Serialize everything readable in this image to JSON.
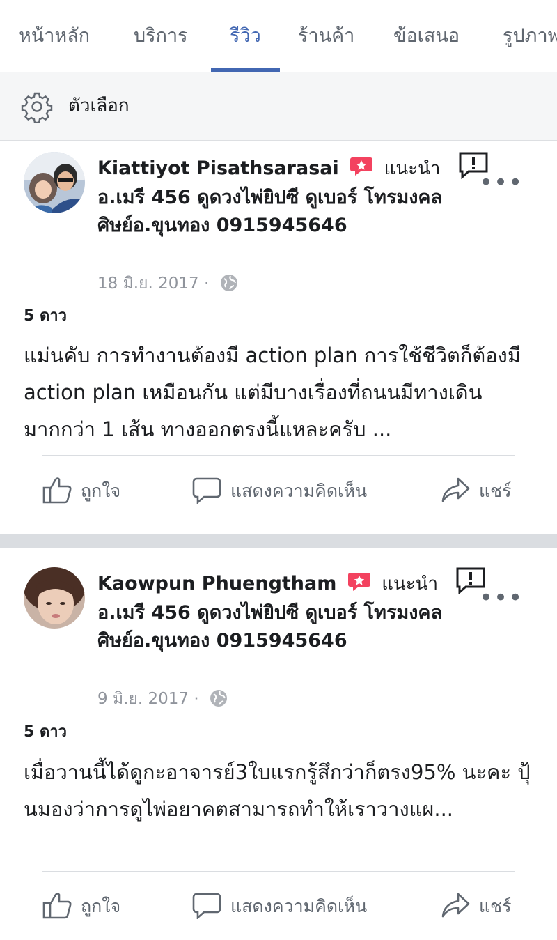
{
  "tabs": [
    "หน้าหลัก",
    "บริการ",
    "รีวิว",
    "ร้านค้า",
    "ข้อเสนอ",
    "รูปภาพ"
  ],
  "options_label": "ตัวเลือก",
  "reviews": [
    {
      "author": "Kiattiyot Pisathsarasai",
      "recommends": "แนะนำ",
      "page_name": "อ.เมรี 456 ดูดวงไพ่ยิปซี ดูเบอร์ โทรมงคล ศิษย์อ.ขุนทอง 0915945646",
      "date": "18 มิ.ย. 2017 ·",
      "rating": "5 ดาว",
      "text": "แม่นคับ การทำงานต้องมี action plan การใช้ชีวิตก็ต้องมี action plan เหมือนกัน แต่มีบางเรื่องที่ถนนมีทางเดินมากกว่า 1 เส้น ทางออกตรงนี้แหละครับ ...",
      "actions": {
        "like": "ถูกใจ",
        "comment": "แสดงความคิดเห็น",
        "share": "แชร์"
      }
    },
    {
      "author": "Kaowpun Phuengtham",
      "recommends": "แนะนำ",
      "page_name": "อ.เมรี 456 ดูดวงไพ่ยิปซี ดูเบอร์ โทรมงคล ศิษย์อ.ขุนทอง 0915945646",
      "date": "9 มิ.ย. 2017 ·",
      "rating": "5 ดาว",
      "text": "เมื่อวานนี้ได้ดูกะอาจารย์3ใบแรกรู้สึกว่าก็ตรง95% นะคะ ปุ้นมองว่าการดูไพ่อยาคตสามารถทำให้เราวางแผ...",
      "actions": {
        "like": "ถูกใจ",
        "comment": "แสดงความคิดเห็น",
        "share": "แชร์"
      }
    }
  ],
  "colors": {
    "accent": "#4267b2",
    "recommend_badge": "#f3425f",
    "muted": "#606770"
  }
}
